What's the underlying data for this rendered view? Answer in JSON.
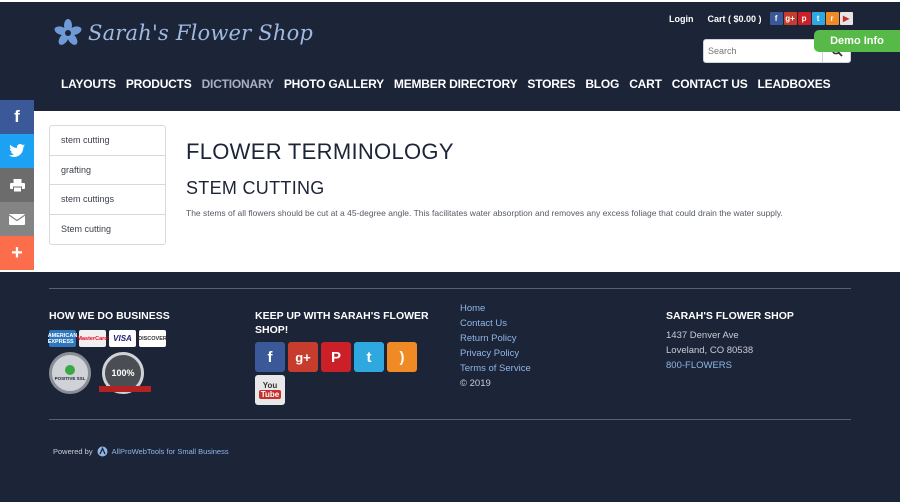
{
  "header": {
    "logo_text": "Sarah's Flower Shop",
    "login_label": "Login",
    "cart_label": "Cart ( $0.00 )",
    "mini_social": [
      "facebook-icon",
      "google-plus-icon",
      "pinterest-icon",
      "twitter-icon",
      "rss-icon",
      "youtube-icon"
    ],
    "search_placeholder": "Search",
    "demo_info_label": "Demo Info"
  },
  "nav": {
    "items": [
      "LAYOUTS",
      "PRODUCTS",
      "DICTIONARY",
      "PHOTO GALLERY",
      "MEMBER DIRECTORY",
      "STORES",
      "BLOG",
      "CART",
      "CONTACT US",
      "LEADBOXES"
    ],
    "active": "DICTIONARY"
  },
  "share_bar": {
    "buttons": [
      {
        "icon": "facebook-icon",
        "glyph": "f",
        "color": "#3b5998"
      },
      {
        "icon": "twitter-icon",
        "glyph": "t",
        "color": "#1da1f2"
      },
      {
        "icon": "print-icon",
        "glyph": "p",
        "color": "#6c6c6c"
      },
      {
        "icon": "email-icon",
        "glyph": "e",
        "color": "#848484"
      },
      {
        "icon": "plus-icon",
        "glyph": "+",
        "color": "#fc6d4c"
      }
    ]
  },
  "sidebar": {
    "items": [
      "stem cutting",
      "grafting",
      "stem cuttings",
      "Stem cutting"
    ]
  },
  "main": {
    "page_title": "FLOWER TERMINOLOGY",
    "term_heading": "STEM CUTTING",
    "term_description": "The stems of all flowers should be cut at a 45-degree angle. This facilitates water absorption and removes any excess foliage that could drain the water supply."
  },
  "footer": {
    "business_heading": "HOW WE DO BUSINESS",
    "payment_cards": [
      "AMERICAN EXPRESS",
      "MasterCard",
      "VISA",
      "DISCOVER"
    ],
    "seal_positive": "POSITIVE SSL",
    "seal_guarantee": "100%",
    "social_heading": "KEEP UP WITH SARAH'S FLOWER SHOP!",
    "social_icons": [
      "facebook-icon",
      "google-plus-icon",
      "pinterest-icon",
      "twitter-icon",
      "rss-icon",
      "youtube-icon"
    ],
    "links": [
      "Home",
      "Contact Us",
      "Return Policy",
      "Privacy Policy",
      "Terms of Service"
    ],
    "copyright": "© 2019",
    "shop_heading": "SARAH'S FLOWER SHOP",
    "address_line1": "1437 Denver Ave",
    "address_line2": "Loveland, CO 80538",
    "phone": "800-FLOWERS",
    "powered_by_prefix": "Powered by",
    "powered_by_link": "AllProWebTools for Small Business"
  },
  "colors": {
    "navy": "#1c2438",
    "link_blue": "#8fb6e6",
    "demo_green": "#57b948",
    "nav_active": "#a9b0bf"
  }
}
